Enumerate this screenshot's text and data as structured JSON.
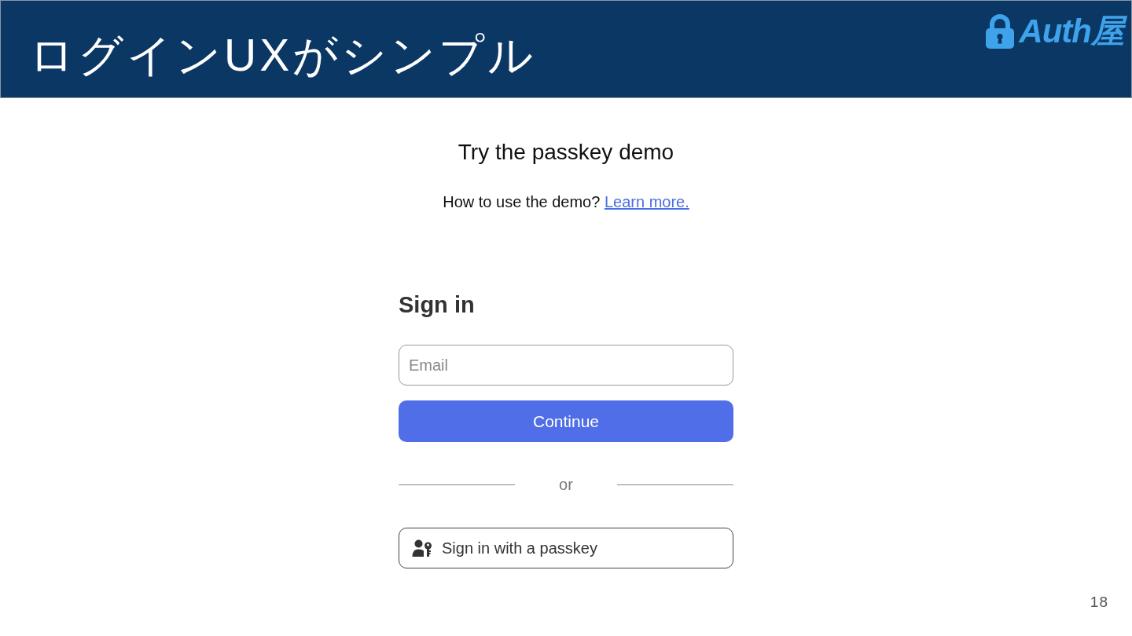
{
  "header": {
    "title": "ログインUXがシンプル",
    "logo": "Auth屋"
  },
  "demo": {
    "heading": "Try the passkey demo",
    "help_text": "How to use the demo?",
    "help_link": "Learn more."
  },
  "sign_in": {
    "title": "Sign in",
    "email": {
      "placeholder": "Email"
    },
    "continue_button": "Continue",
    "divider": "or",
    "passkey_button": "Sign in with a passkey"
  },
  "page_number": "18"
}
